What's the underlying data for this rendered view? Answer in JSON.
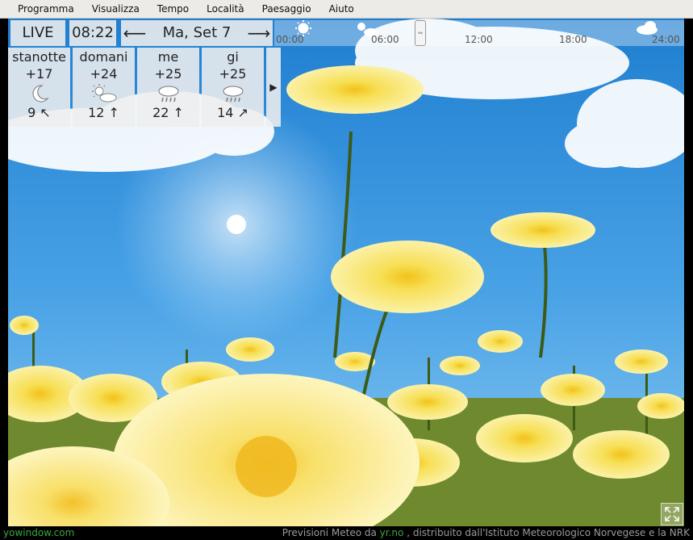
{
  "menu": [
    "Programma",
    "Visualizza",
    "Tempo",
    "Località",
    "Paesaggio",
    "Aiuto"
  ],
  "topbar": {
    "live_label": "LIVE",
    "time": "08:22",
    "prev_arrow": "⟵",
    "date": "Ma, Set 7",
    "next_arrow": "⟶",
    "timeline_ticks": [
      "00:00",
      "06:00",
      "12:00",
      "18:00",
      "24:00"
    ]
  },
  "forecast": [
    {
      "name": "stanotte",
      "temp": "+17",
      "icon": "moon-icon",
      "wind": "9 ↖"
    },
    {
      "name": "domani",
      "temp": "+24",
      "icon": "sun-cloud-icon",
      "wind": "12 ↑"
    },
    {
      "name": "me",
      "temp": "+25",
      "icon": "rain-cloud-icon",
      "wind": "22 ↑"
    },
    {
      "name": "gi",
      "temp": "+25",
      "icon": "rain-cloud-icon",
      "wind": "14 ↗"
    }
  ],
  "forecast_next": "▶",
  "status": {
    "site": "yowindow.com",
    "credit_prefix": "Previsioni Meteo da ",
    "credit_link": "yr.no",
    "credit_suffix": ", distribuito dall'Istituto Meteorologico Norvegese e la NRK"
  }
}
